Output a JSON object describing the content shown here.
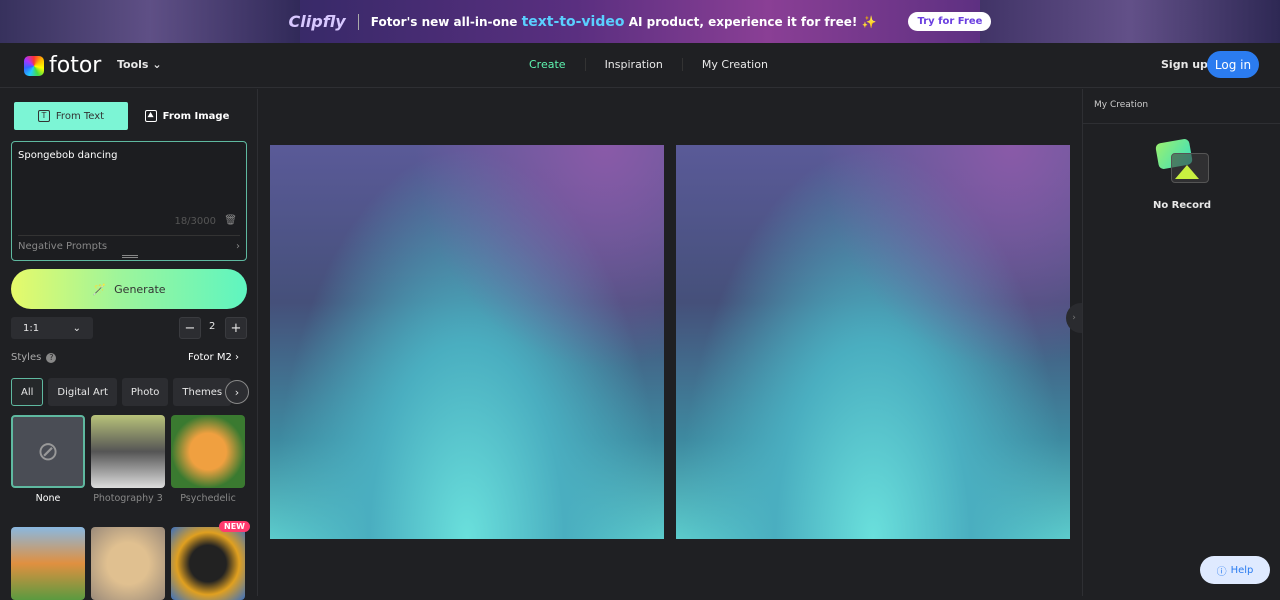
{
  "banner": {
    "brand": "Clipfly",
    "text_before": "Fotor's new all-in-one",
    "highlight": "text-to-video",
    "text_after": "AI product, experience it for free!",
    "sparkle": "✨",
    "cta": "Try for Free"
  },
  "header": {
    "logo": "fotor",
    "tools": "Tools",
    "nav": [
      "Create",
      "Inspiration",
      "My Creation"
    ],
    "signup": "Sign up",
    "login": "Log in",
    "accent": "#5ef5b0"
  },
  "left": {
    "tabs": [
      "From Text",
      "From Image"
    ],
    "prompt": "Spongebob dancing",
    "counter": "18/3000",
    "negative": "Negative Prompts",
    "generate": "Generate",
    "ratio": "1:1",
    "count": "2",
    "styles_label": "Styles",
    "model": "Fotor M2",
    "chips": [
      "All",
      "Digital Art",
      "Photo",
      "Themes"
    ],
    "thumbs": [
      {
        "label": "None"
      },
      {
        "label": "Photography 3"
      },
      {
        "label": "Psychedelic"
      },
      {
        "label": ""
      },
      {
        "label": ""
      },
      {
        "label": "",
        "badge": "NEW"
      }
    ]
  },
  "right": {
    "title": "My Creation",
    "empty": "No Record"
  },
  "help": "Help"
}
